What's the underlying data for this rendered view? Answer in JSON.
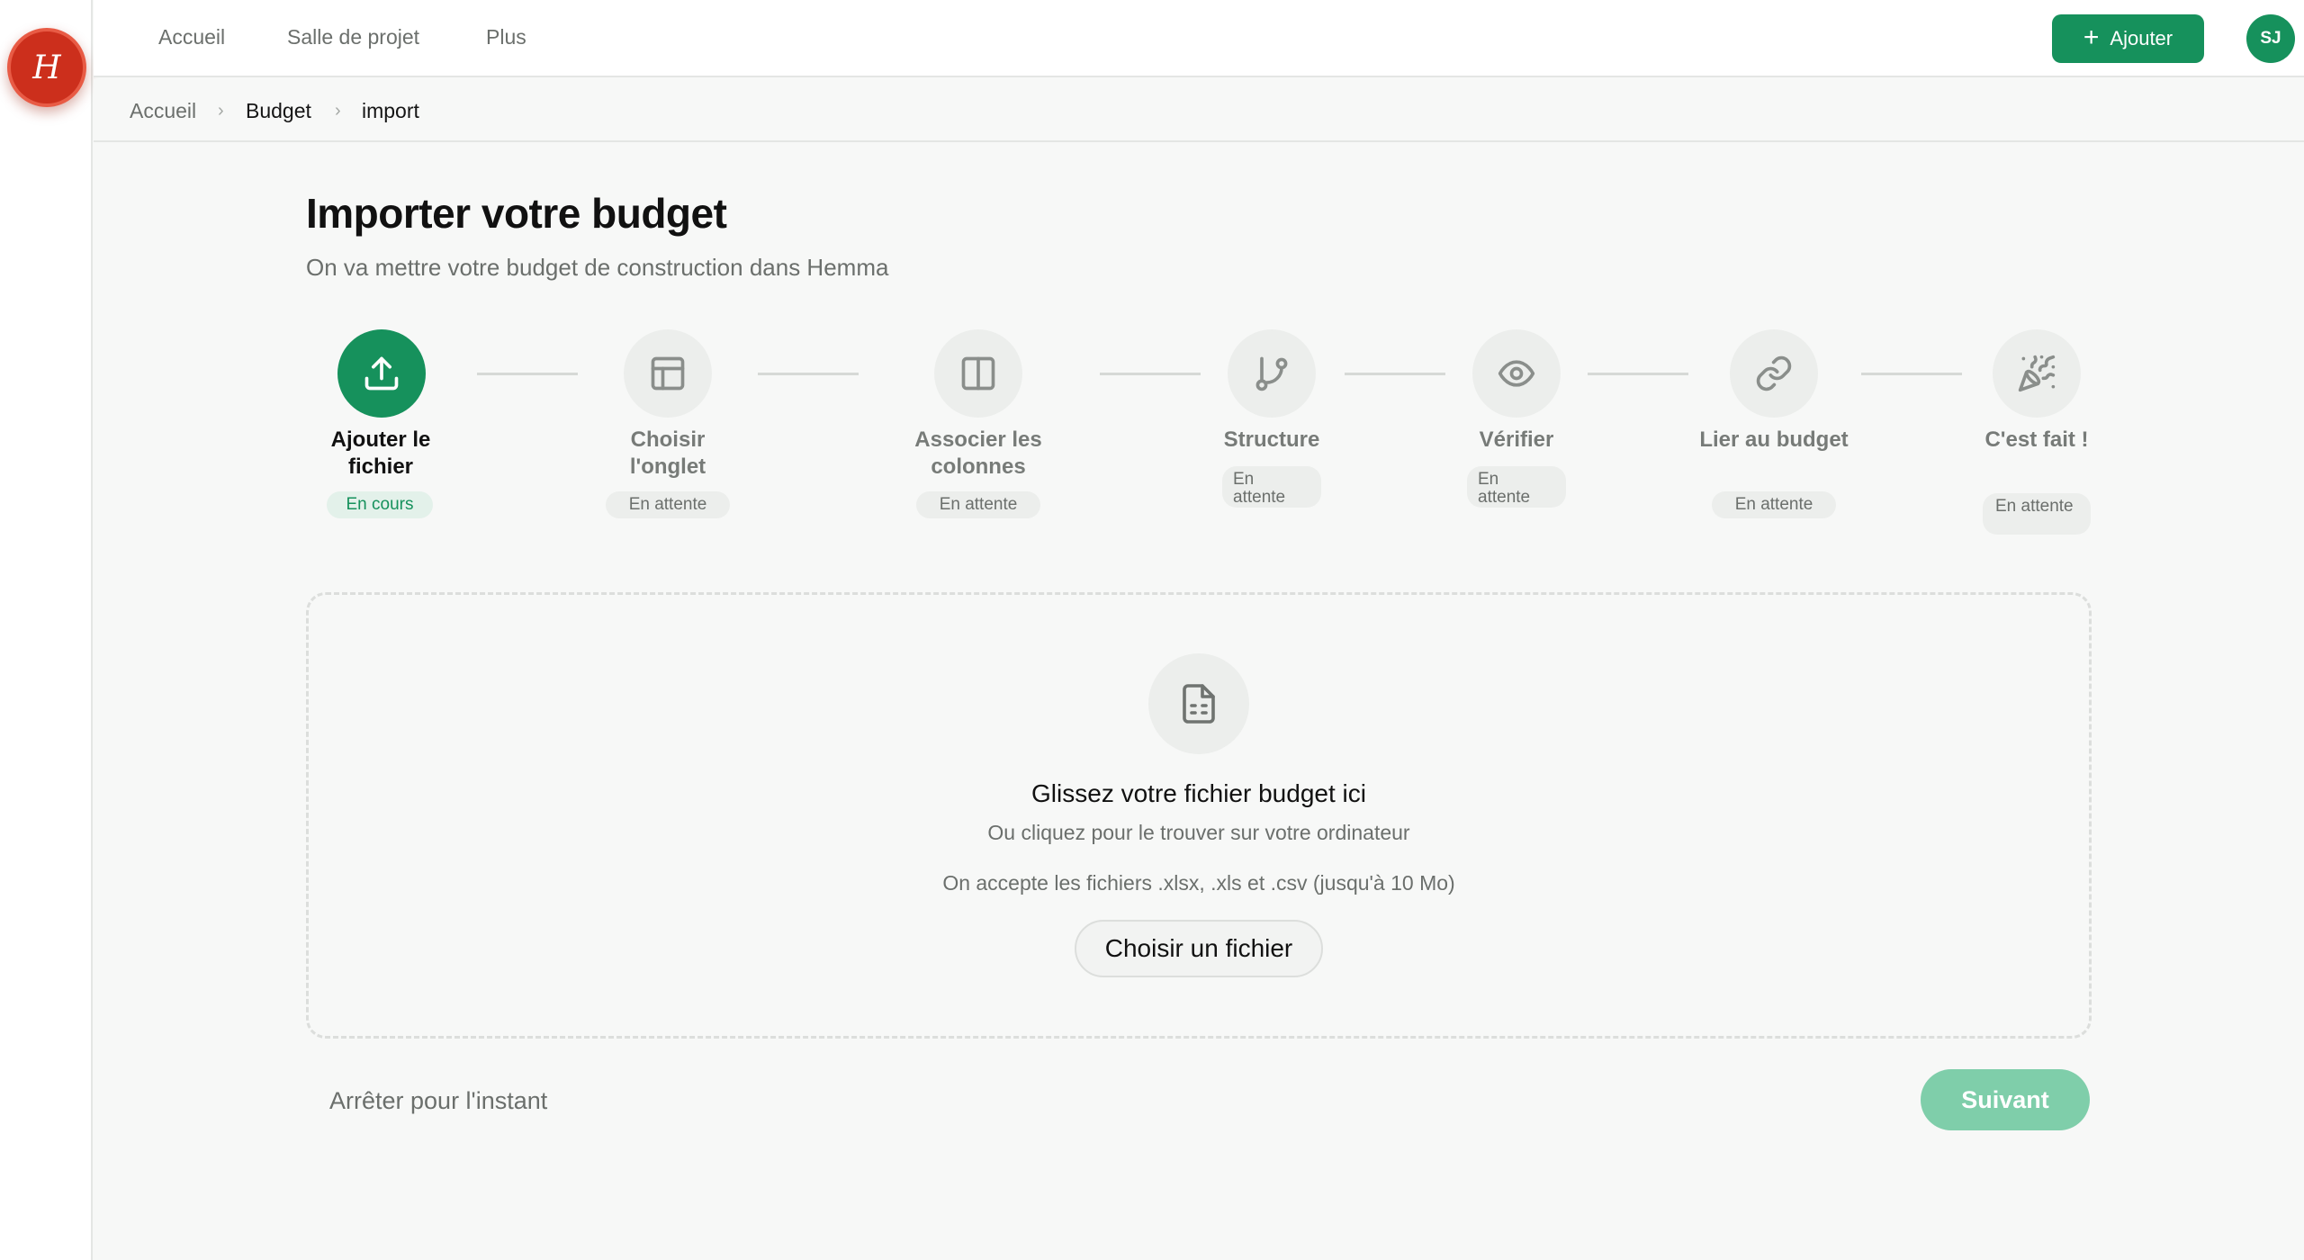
{
  "logo": {
    "letter": "H"
  },
  "topnav": {
    "items": [
      "Accueil",
      "Salle de projet",
      "Plus"
    ]
  },
  "header": {
    "add_label": "Ajouter",
    "add_icon": "plus-icon",
    "avatar_initials": "SJ"
  },
  "breadcrumb": {
    "items": [
      "Accueil",
      "Budget",
      "import"
    ]
  },
  "page": {
    "title": "Importer votre budget",
    "subtitle": "On va mettre votre budget de construction dans Hemma"
  },
  "steps": [
    {
      "label": "Ajouter le fichier",
      "status": "En cours",
      "icon": "upload-icon",
      "active": true
    },
    {
      "label": "Choisir l'onglet",
      "status": "En attente",
      "icon": "table-icon",
      "active": false
    },
    {
      "label": "Associer les colonnes",
      "status": "En attente",
      "icon": "columns-icon",
      "active": false
    },
    {
      "label": "Structure",
      "status": "En attente",
      "icon": "git-branch-icon",
      "active": false
    },
    {
      "label": "Vérifier",
      "status": "En attente",
      "icon": "eye-icon",
      "active": false
    },
    {
      "label": "Lier au budget",
      "status": "En attente",
      "icon": "link-icon",
      "active": false
    },
    {
      "label": "C'est fait !",
      "status": "En attente",
      "icon": "party-popper-icon",
      "active": false
    }
  ],
  "dropzone": {
    "icon": "file-spreadsheet-icon",
    "title": "Glissez votre fichier budget ici",
    "subtitle": "Ou cliquez pour le trouver sur votre ordinateur",
    "accepted": "On accepte les fichiers .xlsx, .xls et .csv (jusqu'à 10 Mo)",
    "button_label": "Choisir un fichier"
  },
  "footer": {
    "stop_label": "Arrêter pour l'instant",
    "next_label": "Suivant"
  },
  "colors": {
    "brand_green": "#16915c",
    "disabled_green": "#7fceaa",
    "logo_red": "#cc2f1c"
  }
}
